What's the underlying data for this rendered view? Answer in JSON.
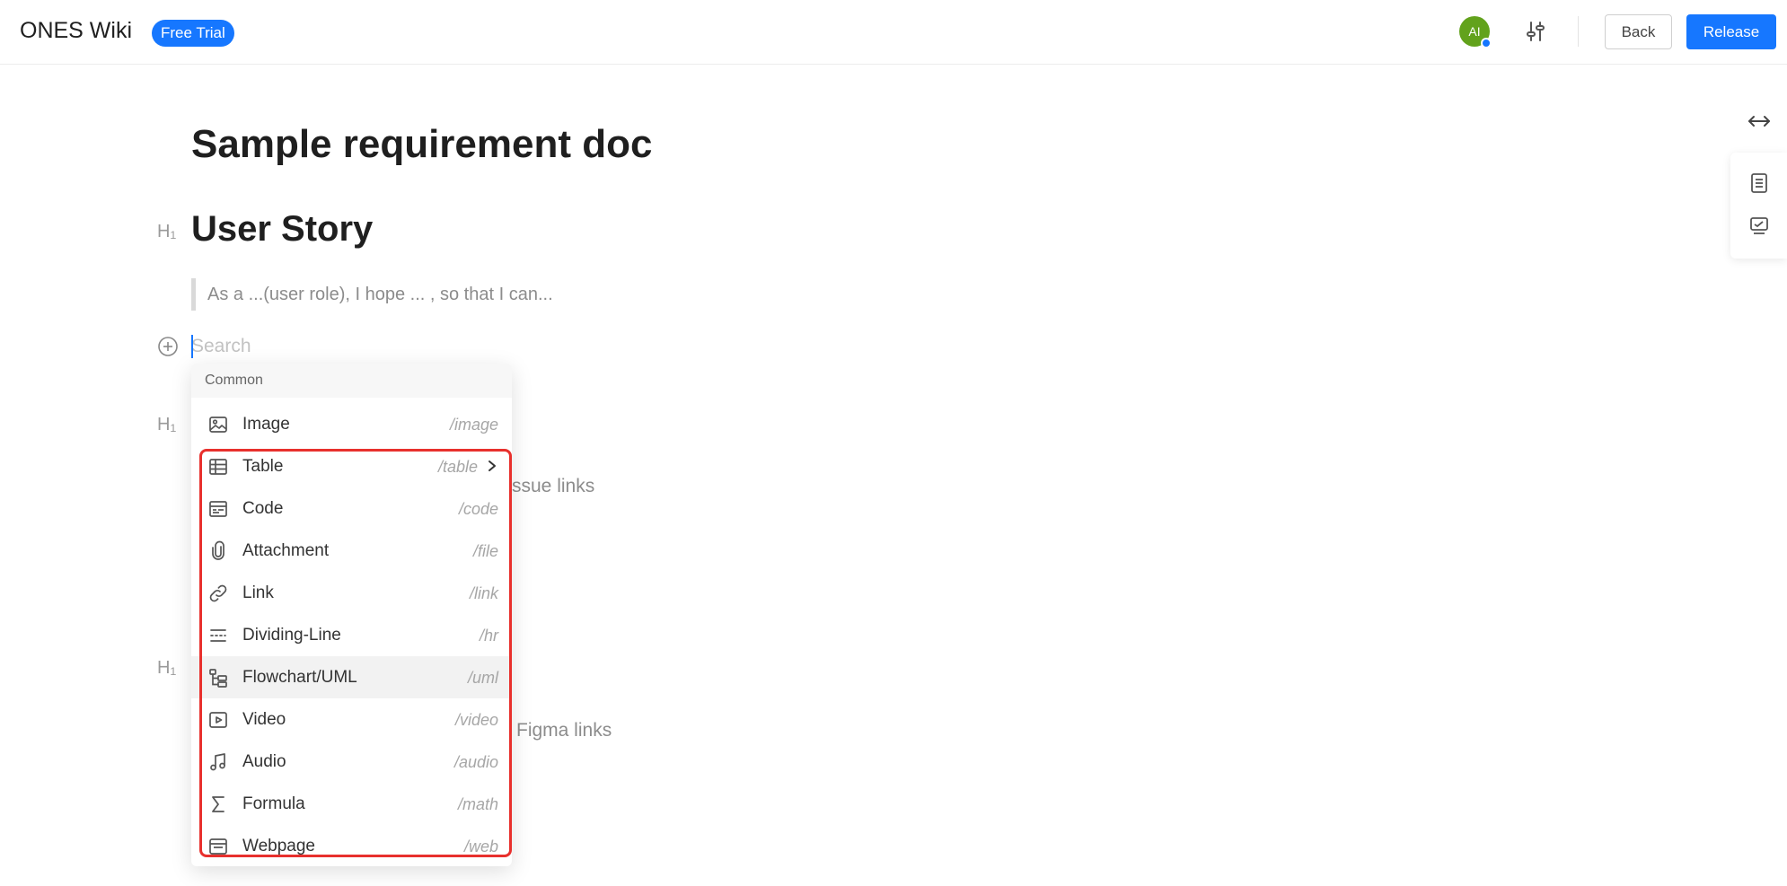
{
  "header": {
    "app_title": "ONES Wiki",
    "trial_badge": "Free Trial",
    "avatar_initials": "AI",
    "back_label": "Back",
    "release_label": "Release"
  },
  "colors": {
    "primary": "#1677ff",
    "avatar": "#62a21c",
    "highlight": "#e8302d"
  },
  "icons": {
    "header": [
      "settings-icon"
    ],
    "right_toolbar": [
      "expand-arrows-icon",
      "document-outline-icon",
      "comment-icon"
    ]
  },
  "document": {
    "title": "Sample requirement doc",
    "heading_marker": "H₁",
    "sections": [
      {
        "heading": "User Story",
        "quote": "As a ...(user role), I hope ... , so that I can..."
      }
    ],
    "partially_hidden_text": [
      "ssue links",
      "Figma links"
    ],
    "search_placeholder": "Search"
  },
  "slash_menu": {
    "section": "Common",
    "items": [
      {
        "label": "Image",
        "shortcut": "/image",
        "icon": "image-icon"
      },
      {
        "label": "Table",
        "shortcut": "/table",
        "icon": "table-icon",
        "has_submenu": true
      },
      {
        "label": "Code",
        "shortcut": "/code",
        "icon": "code-icon"
      },
      {
        "label": "Attachment",
        "shortcut": "/file",
        "icon": "paperclip-icon"
      },
      {
        "label": "Link",
        "shortcut": "/link",
        "icon": "link-icon"
      },
      {
        "label": "Dividing-Line",
        "shortcut": "/hr",
        "icon": "divider-icon"
      },
      {
        "label": "Flowchart/UML",
        "shortcut": "/uml",
        "icon": "flowchart-icon",
        "hovered": true
      },
      {
        "label": "Video",
        "shortcut": "/video",
        "icon": "video-icon"
      },
      {
        "label": "Audio",
        "shortcut": "/audio",
        "icon": "music-note-icon"
      },
      {
        "label": "Formula",
        "shortcut": "/math",
        "icon": "sigma-icon"
      },
      {
        "label": "Webpage",
        "shortcut": "/web",
        "icon": "webpage-icon"
      }
    ]
  }
}
